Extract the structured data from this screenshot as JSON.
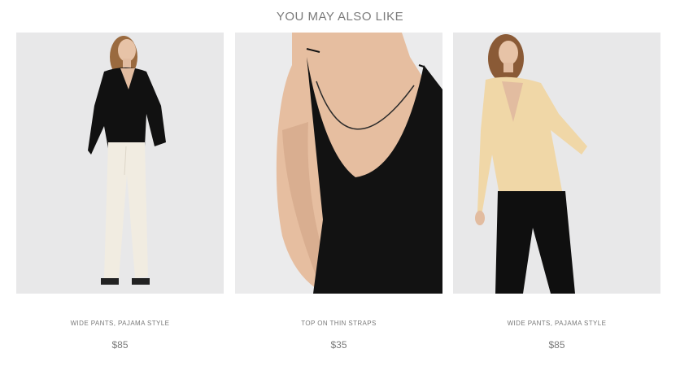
{
  "section": {
    "title": "YOU MAY ALSO LIKE"
  },
  "products": [
    {
      "name": "WIDE PANTS, PAJAMA STYLE",
      "price": "$85"
    },
    {
      "name": "TOP ON THIN STRAPS",
      "price": "$35"
    },
    {
      "name": "WIDE PANTS, PAJAMA STYLE",
      "price": "$85"
    }
  ]
}
